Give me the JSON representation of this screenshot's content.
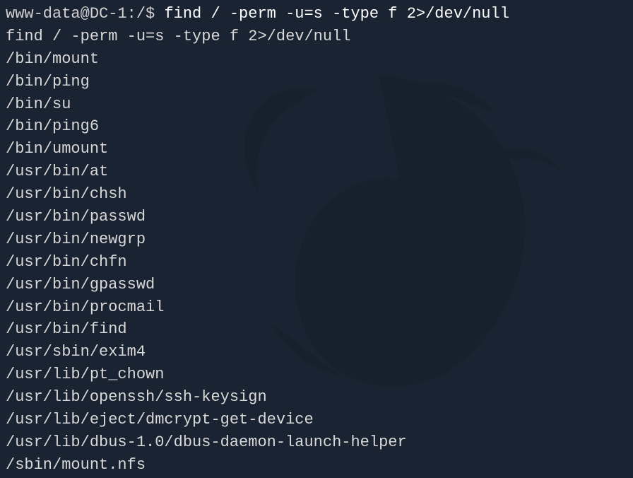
{
  "terminal": {
    "prompt": "www-data@DC-1:/$ ",
    "command": "find / -perm -u=s -type f 2>/dev/null",
    "echo": "find / -perm -u=s -type f 2>/dev/null",
    "output": [
      "/bin/mount",
      "/bin/ping",
      "/bin/su",
      "/bin/ping6",
      "/bin/umount",
      "/usr/bin/at",
      "/usr/bin/chsh",
      "/usr/bin/passwd",
      "/usr/bin/newgrp",
      "/usr/bin/chfn",
      "/usr/bin/gpasswd",
      "/usr/bin/procmail",
      "/usr/bin/find",
      "/usr/sbin/exim4",
      "/usr/lib/pt_chown",
      "/usr/lib/openssh/ssh-keysign",
      "/usr/lib/eject/dmcrypt-get-device",
      "/usr/lib/dbus-1.0/dbus-daemon-launch-helper",
      "/sbin/mount.nfs"
    ]
  }
}
